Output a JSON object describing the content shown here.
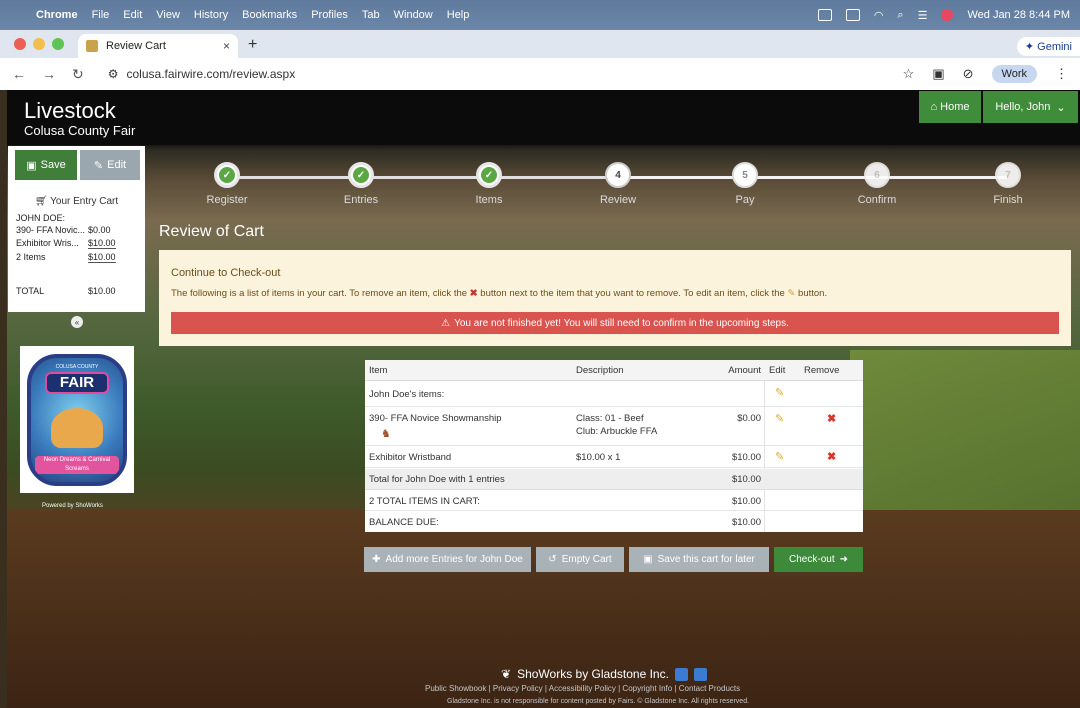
{
  "macbar": {
    "app": "Chrome",
    "menus": [
      "File",
      "Edit",
      "View",
      "History",
      "Bookmarks",
      "Profiles",
      "Tab",
      "Window",
      "Help"
    ],
    "datetime": "Wed Jan 28  8:44 PM"
  },
  "browser": {
    "tab_title": "Review Cart",
    "gemini_label": "Gemini",
    "url": "colusa.fairwire.com/review.aspx",
    "profile_label": "Work"
  },
  "site": {
    "title": "Livestock",
    "subtitle": "Colusa County Fair",
    "home_label": "Home",
    "user_label": "Hello, John"
  },
  "cart_panel": {
    "save_label": "Save",
    "edit_label": "Edit",
    "title": "Your Entry Cart",
    "exhibitor": "JOHN DOE:",
    "lines": [
      {
        "label": "390- FFA Novic...",
        "amount": "$0.00"
      },
      {
        "label": "Exhibitor Wris...",
        "amount": "$10.00"
      },
      {
        "label": "2 Items",
        "amount": "$10.00"
      }
    ],
    "total_label": "TOTAL",
    "total_amount": "$10.00"
  },
  "logo": {
    "top_text": "COLUSA COUNTY",
    "main_text": "FAIR",
    "bottom_text": "Neon Dreams & Carnival Screams"
  },
  "powered_by": "Powered by ShoWorks",
  "steps": [
    {
      "number": "",
      "label": "Register",
      "state": "done"
    },
    {
      "number": "",
      "label": "Entries",
      "state": "done"
    },
    {
      "number": "",
      "label": "Items",
      "state": "done"
    },
    {
      "number": "4",
      "label": "Review",
      "state": "current"
    },
    {
      "number": "5",
      "label": "Pay",
      "state": "pending"
    },
    {
      "number": "6",
      "label": "Confirm",
      "state": "faded"
    },
    {
      "number": "7",
      "label": "Finish",
      "state": "faded"
    }
  ],
  "page_heading": "Review of Cart",
  "notice": {
    "title": "Continue to Check-out",
    "text_part1": "The following is a list of items in your cart. To remove an item, click the",
    "text_part2": "button next to the item that you want to remove. To edit an item, click the",
    "text_part3": "button.",
    "warning": "You are not finished yet! You will still need to confirm in the upcoming steps."
  },
  "table": {
    "headers": {
      "item": "Item",
      "description": "Description",
      "amount": "Amount",
      "edit": "Edit",
      "remove": "Remove"
    },
    "owner_row": "John Doe's items:",
    "rows": [
      {
        "item": "390- FFA Novice Showmanship",
        "desc1": "Class: 01 - Beef",
        "desc2": "Club: Arbuckle FFA",
        "amount": "$0.00"
      },
      {
        "item": "Exhibitor Wristband",
        "desc1": "$10.00 x 1",
        "desc2": "",
        "amount": "$10.00"
      }
    ],
    "total_for": {
      "label": "Total for John Doe with 1 entries",
      "amount": "$10.00"
    },
    "total_items": {
      "label": "2 TOTAL ITEMS IN CART:",
      "amount": "$10.00"
    },
    "balance": {
      "label": "BALANCE DUE:",
      "amount": "$10.00"
    }
  },
  "actions": {
    "add_more": "Add more Entries for John Doe",
    "empty": "Empty Cart",
    "save_later": "Save this cart for later",
    "checkout": "Check-out"
  },
  "footer": {
    "brand": "ShoWorks by Gladstone Inc.",
    "links": "Public Showbook | Privacy Policy | Accessibility Policy | Copyright Info | Contact Products",
    "copyright": "Gladstone Inc. is not responsible for content posted by Fairs. © Gladstone Inc. All rights reserved."
  }
}
